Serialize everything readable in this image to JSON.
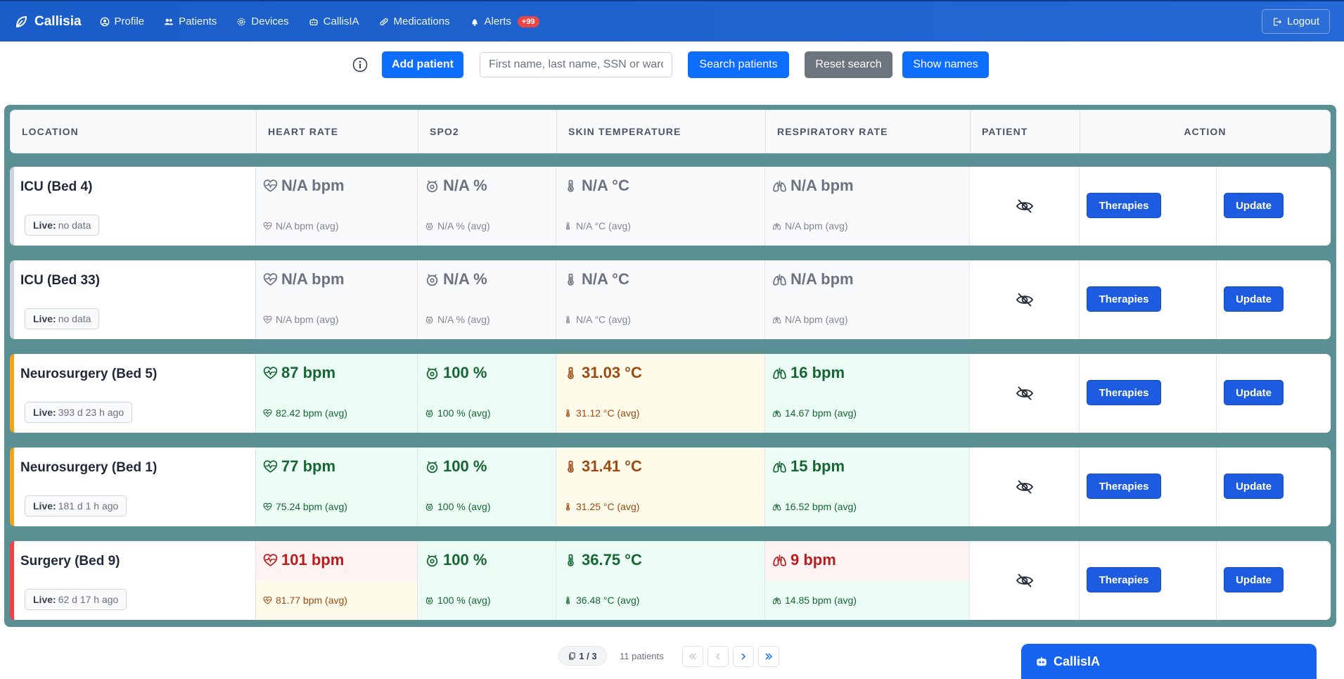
{
  "nav": {
    "brand": "Callisia",
    "items": [
      {
        "label": "Profile",
        "icon": "user-circle-icon"
      },
      {
        "label": "Patients",
        "icon": "users-icon"
      },
      {
        "label": "Devices",
        "icon": "gear-icon"
      },
      {
        "label": "CallisIA",
        "icon": "robot-icon"
      },
      {
        "label": "Medications",
        "icon": "pill-icon"
      },
      {
        "label": "Alerts",
        "icon": "bell-icon"
      }
    ],
    "alerts_badge": "+99",
    "logout": "Logout"
  },
  "toolbar": {
    "add_patient": "Add patient",
    "search_placeholder": "First name, last name, SSN or ward",
    "search_patients": "Search patients",
    "reset_search": "Reset search",
    "show_names": "Show names"
  },
  "table": {
    "headers": [
      "LOCATION",
      "HEART RATE",
      "SPO2",
      "SKIN TEMPERATURE",
      "RESPIRATORY RATE",
      "PATIENT",
      "ACTION"
    ],
    "live_label": "Live:",
    "rows": [
      {
        "location": "ICU (Bed 4)",
        "live": "no data",
        "hr": "N/A bpm",
        "hr_avg": "N/A bpm (avg)",
        "spo2": "N/A %",
        "spo2_avg": "N/A % (avg)",
        "temp": "N/A °C",
        "temp_avg": "N/A °C (avg)",
        "rr": "N/A bpm",
        "rr_avg": "N/A bpm (avg)",
        "therapies": "Therapies",
        "update": "Update"
      },
      {
        "location": "ICU (Bed 33)",
        "live": "no data",
        "hr": "N/A bpm",
        "hr_avg": "N/A bpm (avg)",
        "spo2": "N/A %",
        "spo2_avg": "N/A % (avg)",
        "temp": "N/A °C",
        "temp_avg": "N/A °C (avg)",
        "rr": "N/A bpm",
        "rr_avg": "N/A bpm (avg)",
        "therapies": "Therapies",
        "update": "Update"
      },
      {
        "location": "Neurosurgery (Bed 5)",
        "live": "393 d 23 h ago",
        "hr": "87 bpm",
        "hr_avg": "82.42 bpm (avg)",
        "spo2": "100 %",
        "spo2_avg": "100 % (avg)",
        "temp": "31.03 °C",
        "temp_avg": "31.12 °C (avg)",
        "rr": "16 bpm",
        "rr_avg": "14.67 bpm (avg)",
        "therapies": "Therapies",
        "update": "Update"
      },
      {
        "location": "Neurosurgery (Bed 1)",
        "live": "181 d 1 h ago",
        "hr": "77 bpm",
        "hr_avg": "75.24 bpm (avg)",
        "spo2": "100 %",
        "spo2_avg": "100 % (avg)",
        "temp": "31.41 °C",
        "temp_avg": "31.25 °C (avg)",
        "rr": "15 bpm",
        "rr_avg": "16.52 bpm (avg)",
        "therapies": "Therapies",
        "update": "Update"
      },
      {
        "location": "Surgery (Bed 9)",
        "live": "62 d 17 h ago",
        "hr": "101 bpm",
        "hr_avg": "81.77 bpm (avg)",
        "spo2": "100 %",
        "spo2_avg": "100 % (avg)",
        "temp": "36.75 °C",
        "temp_avg": "36.48 °C (avg)",
        "rr": "9 bpm",
        "rr_avg": "14.85 bpm (avg)",
        "therapies": "Therapies",
        "update": "Update"
      }
    ]
  },
  "pager": {
    "page": "1 / 3",
    "count": "11 patients"
  },
  "chat": {
    "title": "CallisIA"
  },
  "colors": {
    "navbar": "#1a5dc8",
    "primary": "#0d6efd",
    "panel": "#5a8f94",
    "ok": "#166534",
    "warn": "#9a4a12",
    "bad": "#b91c1c"
  }
}
